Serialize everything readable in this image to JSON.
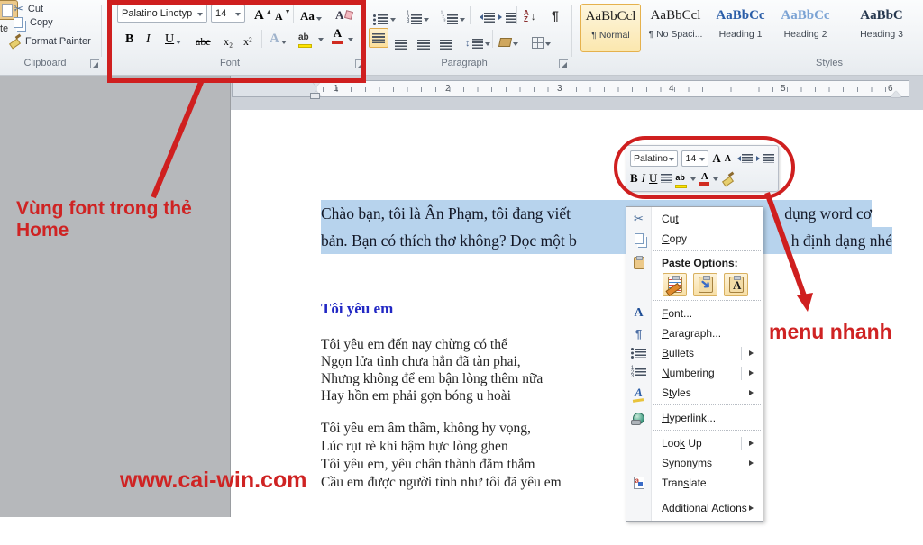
{
  "colors": {
    "annotation_red": "#cf1f1f",
    "selection_blue": "#b7d3ed",
    "heading_blue": "#2228c4",
    "heading1_style": "#2b5ea8",
    "heading2_style": "#7ba3d4"
  },
  "ribbon": {
    "clipboard": {
      "label": "Clipboard",
      "paste_fragment": "te",
      "cut": "Cut",
      "copy": "Copy",
      "format_painter": "Format Painter"
    },
    "font": {
      "label": "Font",
      "font_name": "Palatino Linotyp",
      "font_size": "14",
      "grow": "A",
      "shrink": "A",
      "change_case": "Aa",
      "clear_format": "A",
      "bold": "B",
      "italic": "I",
      "underline": "U",
      "strikethrough": "abe",
      "subscript": "x₂",
      "superscript": "x²",
      "text_effects": "A",
      "highlight": "ab",
      "font_color": "A"
    },
    "paragraph": {
      "label": "Paragraph",
      "pilcrow": "¶",
      "sort_a": "A",
      "sort_z": "Z",
      "sort_arrow": "↓",
      "spacing_arrow": "↕"
    },
    "styles": {
      "label": "Styles",
      "chips": [
        {
          "preview": "AaBbCcl",
          "name": "¶ Normal"
        },
        {
          "preview": "AaBbCcl",
          "name": "¶ No Spaci..."
        },
        {
          "preview": "AaBbCc",
          "name": "Heading 1"
        },
        {
          "preview": "AaBbCc",
          "name": "Heading 2"
        },
        {
          "preview": "AaBbC",
          "name": "Heading 3"
        }
      ]
    }
  },
  "ruler": {
    "numbers": [
      "1",
      "2",
      "3",
      "4",
      "5",
      "6"
    ]
  },
  "mini_toolbar": {
    "font_name": "Palatino",
    "font_size": "14",
    "bold": "B",
    "italic": "I",
    "underline": "U",
    "grow": "A",
    "shrink": "A",
    "highlight": "ab",
    "font_color": "A"
  },
  "context_menu": {
    "cut": {
      "pre": "Cu",
      "key": "t",
      "post": ""
    },
    "copy": {
      "pre": "",
      "key": "C",
      "post": "opy"
    },
    "paste_options_label": "Paste Options:",
    "font": {
      "pre": "",
      "key": "F",
      "post": "ont..."
    },
    "paragraph": {
      "pre": "",
      "key": "P",
      "post": "aragraph..."
    },
    "bullets": {
      "pre": "",
      "key": "B",
      "post": "ullets"
    },
    "numbering": {
      "pre": "",
      "key": "N",
      "post": "umbering"
    },
    "styles": {
      "pre": "S",
      "key": "t",
      "post": "yles"
    },
    "hyperlink": {
      "pre": "",
      "key": "H",
      "post": "yperlink..."
    },
    "look_up": {
      "pre": "Loo",
      "key": "k",
      "post": " Up"
    },
    "synonyms": {
      "pre": "Synonyms",
      "key": "",
      "post": ""
    },
    "translate": {
      "pre": "Tran",
      "key": "s",
      "post": "late"
    },
    "additional_actions": {
      "pre": "",
      "key": "A",
      "post": "dditional Actions"
    },
    "merge_arrow_glyph": "➜",
    "keep_text_glyph": "A",
    "scissors_glyph": "✂",
    "font_a_glyph": "A",
    "pilcrow_glyph": "¶",
    "styles_a_glyph": "A"
  },
  "document": {
    "intro_line1_left": "Chào bạn, tôi là Ân Phạm, tôi đang viết",
    "intro_line1_right": "dụng word cơ",
    "intro_line2_left": "bản. Bạn có thích thơ không? Đọc một b",
    "intro_line2_right": "h định dạng nhé",
    "poem_title": "Tôi yêu em",
    "poem_stanza1": [
      "Tôi yêu em đến nay chừng có thể",
      "Ngọn lửa tình chưa hẳn đã tàn phai,",
      "Nhưng không để em bận lòng thêm nữa",
      "Hay hồn em phải gợn bóng u hoài"
    ],
    "poem_stanza2": [
      "Tôi yêu em âm thầm, không hy vọng,",
      "Lúc rụt rè khi hậm hực lòng ghen",
      "Tôi yêu em, yêu chân thành đằm thắm",
      "Cầu em được người tình như tôi đã yêu em"
    ]
  },
  "annotations": {
    "font_region_label": "Vùng font trong thẻ Home",
    "quick_menu_label": "menu nhanh",
    "watermark": "www.cai-win.com"
  }
}
